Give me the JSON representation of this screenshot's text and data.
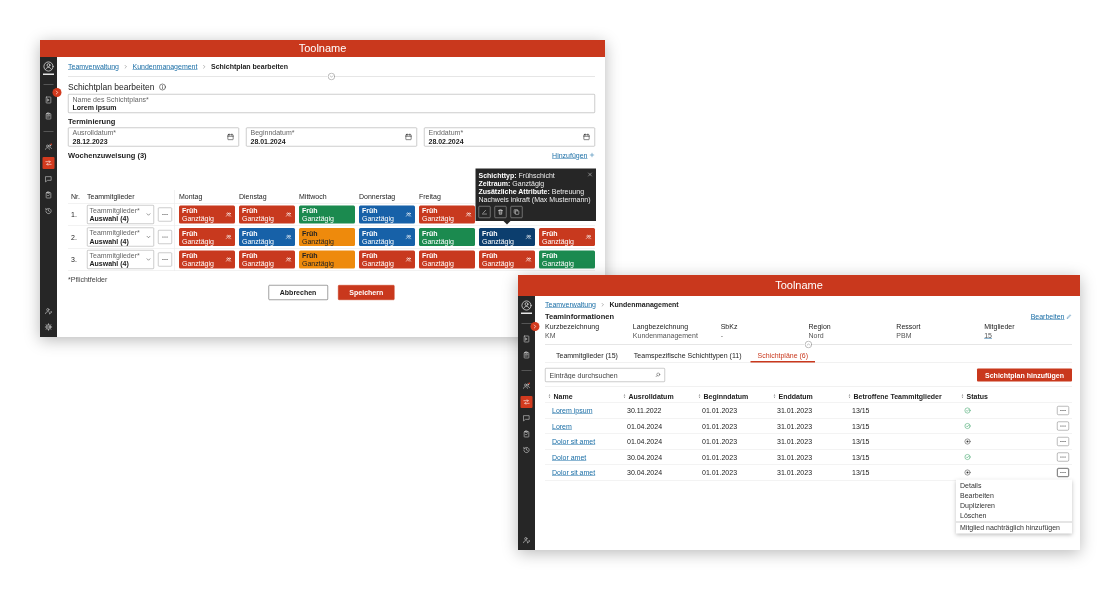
{
  "editor_window": {
    "title": "Toolname",
    "sidebar": {
      "items": [
        {
          "kind": "avatar"
        },
        {
          "kind": "divider"
        },
        {
          "kind": "document",
          "selected": false
        },
        {
          "kind": "clipboard",
          "selected": false
        },
        {
          "kind": "divider"
        },
        {
          "kind": "team",
          "selected": false
        },
        {
          "kind": "shifts",
          "selected": true
        },
        {
          "kind": "chat",
          "selected": false
        },
        {
          "kind": "checklist",
          "selected": false
        },
        {
          "kind": "history",
          "selected": false
        }
      ],
      "bottom_items": [
        {
          "kind": "user"
        },
        {
          "kind": "settings"
        }
      ]
    },
    "breadcrumbs": [
      {
        "label": "Teamverwaltung",
        "kind": "link"
      },
      {
        "label": "Kundenmanagement",
        "kind": "link"
      },
      {
        "label": "Schichtplan bearbeiten",
        "kind": "current"
      }
    ],
    "heading": "Schichtplan bearbeiten",
    "name_field": {
      "label": "Name des Schichtplans*",
      "value": "Lorem ipsum"
    },
    "scheduling": {
      "heading": "Terminierung",
      "fields": [
        {
          "label": "Ausrolldatum*",
          "value": "28.12.2023"
        },
        {
          "label": "Beginndatum*",
          "value": "28.01.2024"
        },
        {
          "label": "Enddatum*",
          "value": "28.02.2024"
        }
      ]
    },
    "week_assignment": {
      "heading": "Wochenzuweisung (3)",
      "add_link": "Hinzufügen",
      "nr_column": "Nr.",
      "members_column": "Teammitglieder",
      "days": [
        {
          "kind": "day",
          "label": "Montag"
        },
        {
          "kind": "day",
          "label": "Dienstag"
        },
        {
          "kind": "day",
          "label": "Mittwoch"
        },
        {
          "kind": "day",
          "label": "Donnerstag"
        },
        {
          "kind": "day",
          "label": "Freitag"
        },
        {
          "kind": "covered"
        },
        {
          "kind": "covered"
        }
      ],
      "rows": [
        {
          "nr": "1.",
          "member_select": {
            "label": "Teammitglieder*",
            "value": "Auswahl (4)"
          },
          "shifts": [
            {
              "kind": "shift",
              "title": "Früh",
              "subtitle": "Ganztägig",
              "color": "#c8391e",
              "group_icon": true
            },
            {
              "kind": "shift",
              "title": "Früh",
              "subtitle": "Ganztägig",
              "color": "#c8391e",
              "group_icon": true
            },
            {
              "kind": "shift",
              "title": "Früh",
              "subtitle": "Ganztägig",
              "color": "#1b8a4f",
              "group_icon": false
            },
            {
              "kind": "shift",
              "title": "Früh",
              "subtitle": "Ganztägig",
              "color": "#1761a8",
              "group_icon": true
            },
            {
              "kind": "shift",
              "title": "Früh",
              "subtitle": "Ganztägig",
              "color": "#c8391e",
              "group_icon": true
            },
            {
              "kind": "covered"
            },
            {
              "kind": "covered"
            }
          ]
        },
        {
          "nr": "2.",
          "member_select": {
            "label": "Teammitglieder*",
            "value": "Auswahl (4)"
          },
          "shifts": [
            {
              "kind": "shift",
              "title": "Früh",
              "subtitle": "Ganztägig",
              "color": "#c8391e",
              "group_icon": true
            },
            {
              "kind": "shift",
              "title": "Früh",
              "subtitle": "Ganztägig",
              "color": "#1761a8",
              "group_icon": true
            },
            {
              "kind": "shift",
              "title": "Früh",
              "subtitle": "Ganztägig",
              "color": "#ee8a0c",
              "group_icon": false
            },
            {
              "kind": "shift",
              "title": "Früh",
              "subtitle": "Ganztägig",
              "color": "#1761a8",
              "group_icon": true
            },
            {
              "kind": "shift",
              "title": "Früh",
              "subtitle": "Ganztägig",
              "color": "#1b8a4f",
              "group_icon": false
            },
            {
              "kind": "shift",
              "title": "Früh",
              "subtitle": "Ganztägig",
              "color": "#0c3e6e",
              "group_icon": true
            },
            {
              "kind": "shift",
              "title": "Früh",
              "subtitle": "Ganztägig",
              "color": "#c8391e",
              "group_icon": true
            }
          ]
        },
        {
          "nr": "3.",
          "member_select": {
            "label": "Teammitglieder*",
            "value": "Auswahl (4)"
          },
          "shifts": [
            {
              "kind": "shift",
              "title": "Früh",
              "subtitle": "Ganztägig",
              "color": "#c8391e",
              "group_icon": true
            },
            {
              "kind": "shift",
              "title": "Früh",
              "subtitle": "Ganztägig",
              "color": "#c8391e",
              "group_icon": true
            },
            {
              "kind": "shift",
              "title": "Früh",
              "subtitle": "Ganztägig",
              "color": "#ee8a0c",
              "group_icon": false
            },
            {
              "kind": "shift",
              "title": "Früh",
              "subtitle": "Ganztägig",
              "color": "#c8391e",
              "group_icon": true
            },
            {
              "kind": "shift",
              "title": "Früh",
              "subtitle": "Ganztägig",
              "color": "#c8391e",
              "group_icon": false
            },
            {
              "kind": "shift",
              "title": "Früh",
              "subtitle": "Ganztägig",
              "color": "#c8391e",
              "group_icon": true
            },
            {
              "kind": "shift",
              "title": "Früh",
              "subtitle": "Ganztägig",
              "color": "#1b8a4f",
              "group_icon": false
            }
          ]
        }
      ],
      "tooltip": {
        "lines": [
          "**Schichttyp:** Frühschicht",
          "**Zeitraum:** Ganztägig",
          "**Zusätzliche Attribute:** Betreuung",
          "Nachweis inkraft (Max Mustermann)"
        ]
      }
    },
    "footnote": "*Pflichtfelder",
    "buttons": [
      {
        "label": "Abbrechen",
        "kind": "secondary"
      },
      {
        "label": "Speichern",
        "kind": "primary"
      }
    ]
  },
  "team_window": {
    "title": "Toolname",
    "sidebar": {
      "items": [
        {
          "kind": "avatar"
        },
        {
          "kind": "divider"
        },
        {
          "kind": "document",
          "selected": false
        },
        {
          "kind": "clipboard",
          "selected": false
        },
        {
          "kind": "divider"
        },
        {
          "kind": "team",
          "selected": false
        },
        {
          "kind": "shifts",
          "selected": true
        },
        {
          "kind": "chat",
          "selected": false
        },
        {
          "kind": "checklist",
          "selected": false
        },
        {
          "kind": "history",
          "selected": false
        }
      ],
      "bottom_items": [
        {
          "kind": "user"
        }
      ]
    },
    "breadcrumbs": [
      {
        "label": "Teamverwaltung",
        "kind": "link"
      },
      {
        "label": "Kundenmanagement",
        "kind": "current"
      }
    ],
    "info": {
      "heading": "Teaminformationen",
      "edit_link": "Bearbeiten",
      "fields": [
        {
          "label": "Kurzbezeichnung",
          "value": "KM",
          "kind": "text"
        },
        {
          "label": "Langbezeichnung",
          "value": "Kundenmanagement",
          "kind": "text"
        },
        {
          "label": "SbKz",
          "value": "-",
          "kind": "text"
        },
        {
          "label": "Region",
          "value": "Nord",
          "kind": "text"
        },
        {
          "label": "Ressort",
          "value": "PBM",
          "kind": "text"
        },
        {
          "label": "Mitglieder",
          "value": "15",
          "kind": "link"
        }
      ]
    },
    "tabs": [
      {
        "label": "Teammitglieder (15)",
        "selected": false
      },
      {
        "label": "Teamspezifische Schichttypen (11)",
        "selected": false
      },
      {
        "label": "Schichtpläne (6)",
        "selected": true
      }
    ],
    "search": {
      "placeholder": "Einträge durchsuchen"
    },
    "add_button": "Schichtplan hinzufügen",
    "table": {
      "columns": [
        "Name",
        "Ausrolldatum",
        "Beginndatum",
        "Enddatum",
        "Betroffene Teammitglieder",
        "Status"
      ],
      "rows": [
        {
          "cells": [
            "Lorem ipsum",
            "30.11.2022",
            "01.01.2023",
            "31.01.2023",
            "13/15"
          ],
          "complete": true,
          "menu_open": false
        },
        {
          "cells": [
            "Lorem",
            "01.04.2024",
            "01.01.2023",
            "31.01.2023",
            "13/15"
          ],
          "complete": true,
          "menu_open": false
        },
        {
          "cells": [
            "Dolor sit amet",
            "01.04.2024",
            "01.01.2023",
            "31.01.2023",
            "13/15"
          ],
          "complete": false,
          "menu_open": false
        },
        {
          "cells": [
            "Dolor amet",
            "30.04.2024",
            "01.01.2023",
            "31.01.2023",
            "13/15"
          ],
          "complete": true,
          "menu_open": false
        },
        {
          "cells": [
            "Dolor sit amet",
            "30.04.2024",
            "01.01.2023",
            "31.01.2023",
            "13/15"
          ],
          "complete": false,
          "menu_open": true
        }
      ]
    },
    "row_menu": {
      "items": [
        {
          "label": "Details",
          "kind": "plain"
        },
        {
          "label": "Bearbeiten",
          "kind": "plain"
        },
        {
          "label": "Duplizieren",
          "kind": "plain"
        },
        {
          "label": "Löschen",
          "kind": "plain"
        },
        {
          "label": "Mitglied nachträglich hinzufügen",
          "kind": "separated"
        }
      ]
    }
  }
}
